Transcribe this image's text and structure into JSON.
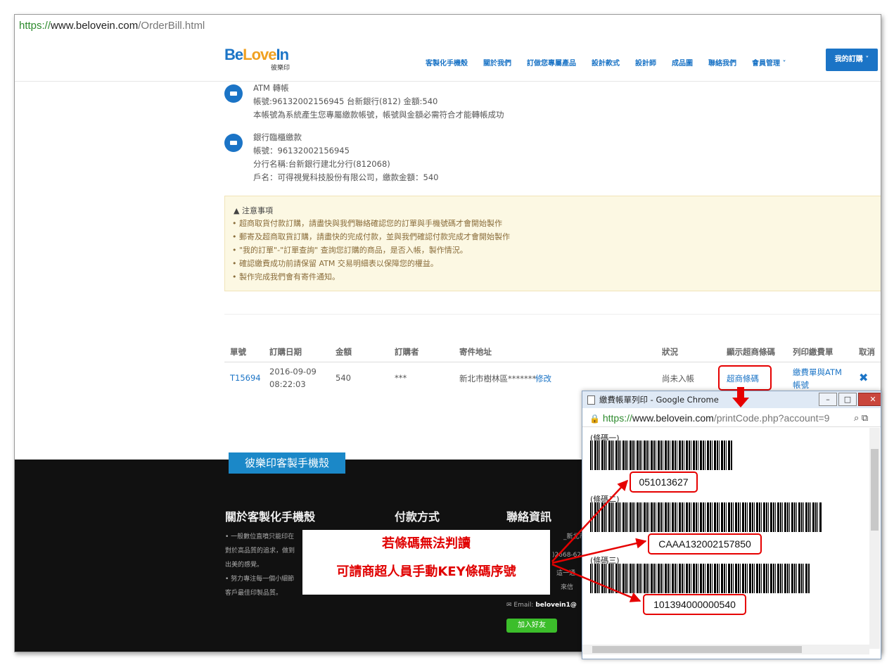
{
  "browser": {
    "url_scheme": "https://",
    "url_host": "www.belovein.com",
    "url_path": "/OrderBill.html"
  },
  "header": {
    "logo_be": "Be",
    "logo_love": "Love",
    "logo_in": "In",
    "logo_sub": "彼樂印",
    "nav": [
      "客製化手機殼",
      "關於我們",
      "訂做您專屬產品",
      "設計款式",
      "設計師",
      "成品圖",
      "聯絡我們",
      "會員管理 ˅"
    ],
    "my_order": "我的訂購 ˅"
  },
  "payments": [
    {
      "title": "ATM 轉帳",
      "lines": [
        "帳號:96132002156945 台新銀行(812) 金額:540",
        "本帳號為系統產生您專屬繳款帳號，帳號與金額必需符合才能轉帳成功"
      ]
    },
    {
      "title": "銀行臨櫃繳款",
      "lines": [
        "帳號：96132002156945",
        "分行名稱:台新銀行建北分行(812068)",
        "戶名：可得視覺科技股份有限公司，繳款金額：540"
      ]
    }
  ],
  "notice": {
    "title": "▲ 注意事項",
    "items": [
      "超商取貨付款訂購，請盡快與我們聯絡確認您的訂單與手機號碼才會開始製作",
      "郵寄及超商取貨訂購，請盡快的完成付款，並與我們確認付款完成才會開始製作",
      "\"我的訂單\"-\"訂單查詢\" 查詢您訂購的商品，是否入帳，製作情況。",
      "確認繳費成功前請保留 ATM 交易明細表以保障您的權益。",
      "製作完成我們會有寄件通知。"
    ]
  },
  "table": {
    "headers": [
      "單號",
      "訂購日期",
      "金額",
      "訂購者",
      "寄件地址",
      "狀況",
      "顯示超商條碼",
      "列印繳費單",
      "取消"
    ],
    "row": {
      "order_no": "T15694",
      "date": "2016-09-09",
      "time": "08:22:03",
      "amount": "540",
      "buyer": "***",
      "address": "新北市樹林區*******",
      "edit": "修改",
      "status": "尚未入帳",
      "barcode_link": "超商條碼",
      "print_line1": "繳費單與ATM",
      "print_line2": "帳號",
      "cancel": "✖"
    }
  },
  "footer": {
    "tab": "彼樂印客製手機殼",
    "col1_title": "關於客製化手機殼",
    "col1_lines": [
      "• 一般數位直噴只能印在",
      "對於高品質的追求，做到",
      "出美的感覺。",
      "• 努力專注每一個小細節",
      "客戶最佳印製品質。"
    ],
    "col2_title": "付款方式",
    "col3_title": "聯絡資訊",
    "col3_fragments": [
      "_新北市",
      ")2668-62",
      "這一通",
      "來信"
    ],
    "email_label": "Email:",
    "email_value": "belovein1@",
    "line_btn": "加入好友"
  },
  "callout": {
    "line1": "若條碼無法判讀",
    "line2": "可請商超人員手動KEY條碼序號"
  },
  "popup": {
    "title": "繳費帳單列印 - Google Chrome",
    "url_scheme": "https://",
    "url_host": "www.belovein.com",
    "url_path": "/printCode.php?account=9",
    "barcodes": [
      {
        "label": "(條碼一)",
        "code": "051013627"
      },
      {
        "label": "(條碼二)",
        "code": "CAAA132002157850"
      },
      {
        "label": "(條碼三)",
        "code": "101394000000540"
      }
    ]
  },
  "colors": {
    "brand_blue": "#1b74c6",
    "highlight_red": "#e60000",
    "notice_bg": "#fcf8e3"
  }
}
